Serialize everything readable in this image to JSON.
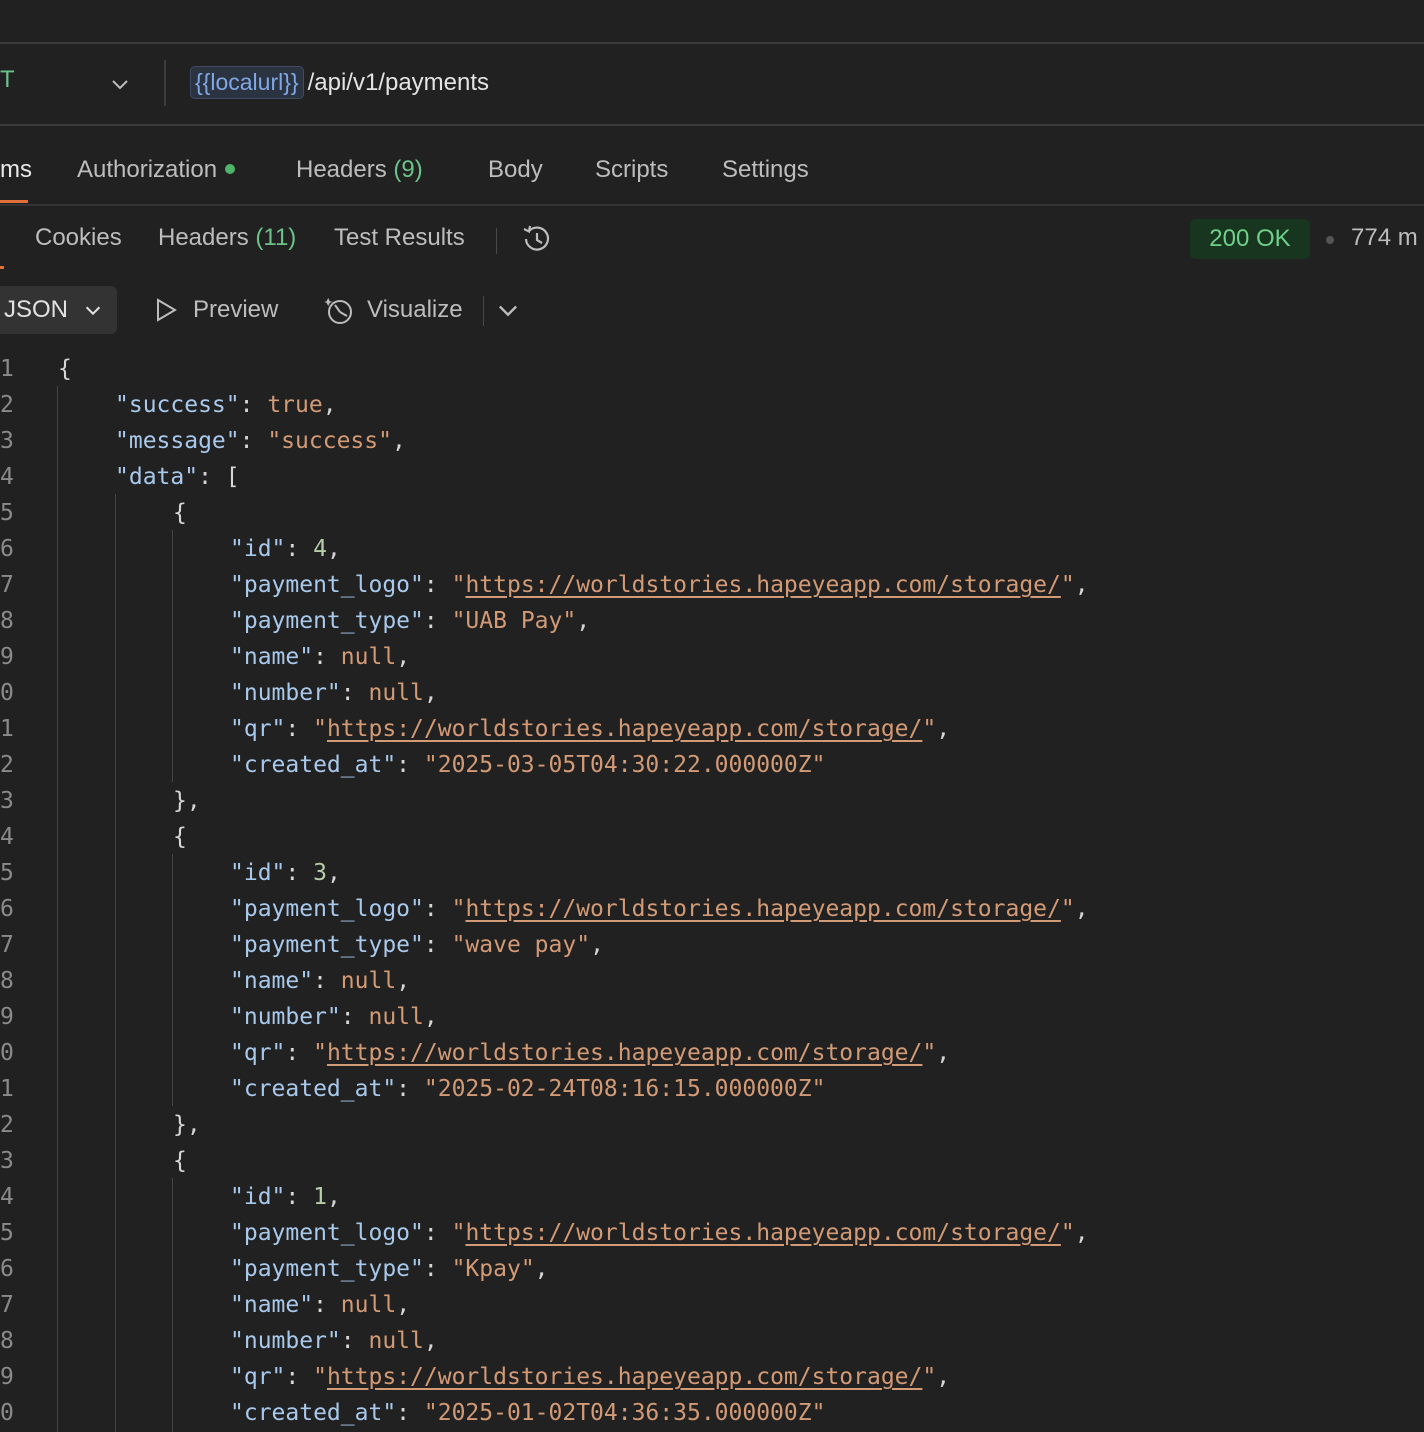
{
  "request": {
    "method": "T",
    "url_variable": "{{localurl}}",
    "url_path": "/api/v1/payments"
  },
  "request_tabs": [
    {
      "label": "ms",
      "active": true
    },
    {
      "label": "Authorization",
      "dot": true
    },
    {
      "label": "Headers",
      "count": "(9)"
    },
    {
      "label": "Body"
    },
    {
      "label": "Scripts"
    },
    {
      "label": "Settings"
    }
  ],
  "response_tabs": [
    {
      "label": "Cookies"
    },
    {
      "label": "Headers",
      "count": "(11)"
    },
    {
      "label": "Test Results"
    }
  ],
  "response_status": "200 OK",
  "response_time": "774 m",
  "toolbar": {
    "format": "JSON",
    "preview": "Preview",
    "visualize": "Visualize"
  },
  "line_numbers": [
    "1",
    "2",
    "3",
    "4",
    "5",
    "6",
    "7",
    "8",
    "9",
    "0",
    "1",
    "2",
    "3",
    "4",
    "5",
    "6",
    "7",
    "8",
    "9",
    "0",
    "1",
    "2",
    "3",
    "4",
    "5",
    "6",
    "7",
    "8",
    "9",
    "0"
  ],
  "json": {
    "success_key": "\"success\"",
    "success_val": "true",
    "message_key": "\"message\"",
    "message_val": "\"success\"",
    "data_key": "\"data\"",
    "items": [
      {
        "id": "4",
        "payment_logo": "https://worldstories.hapeyeapp.com/storage/",
        "payment_type": "\"UAB Pay\"",
        "name": "null",
        "number": "null",
        "qr": "https://worldstories.hapeyeapp.com/storage/",
        "created_at": "\"2025-03-05T04:30:22.000000Z\""
      },
      {
        "id": "3",
        "payment_logo": "https://worldstories.hapeyeapp.com/storage/",
        "payment_type": "\"wave pay\"",
        "name": "null",
        "number": "null",
        "qr": "https://worldstories.hapeyeapp.com/storage/",
        "created_at": "\"2025-02-24T08:16:15.000000Z\""
      },
      {
        "id": "1",
        "payment_logo": "https://worldstories.hapeyeapp.com/storage/",
        "payment_type": "\"Kpay\"",
        "name": "null",
        "number": "null",
        "qr": "https://worldstories.hapeyeapp.com/storage/",
        "created_at": "\"2025-01-02T04:36:35.000000Z\""
      }
    ]
  },
  "icons": {
    "method_dropdown": "chevron-down-icon",
    "history": "history-icon",
    "format_dropdown": "chevron-down-icon",
    "preview": "play-icon",
    "visualize": "visualize-icon",
    "visualize_dropdown": "chevron-down-icon"
  }
}
